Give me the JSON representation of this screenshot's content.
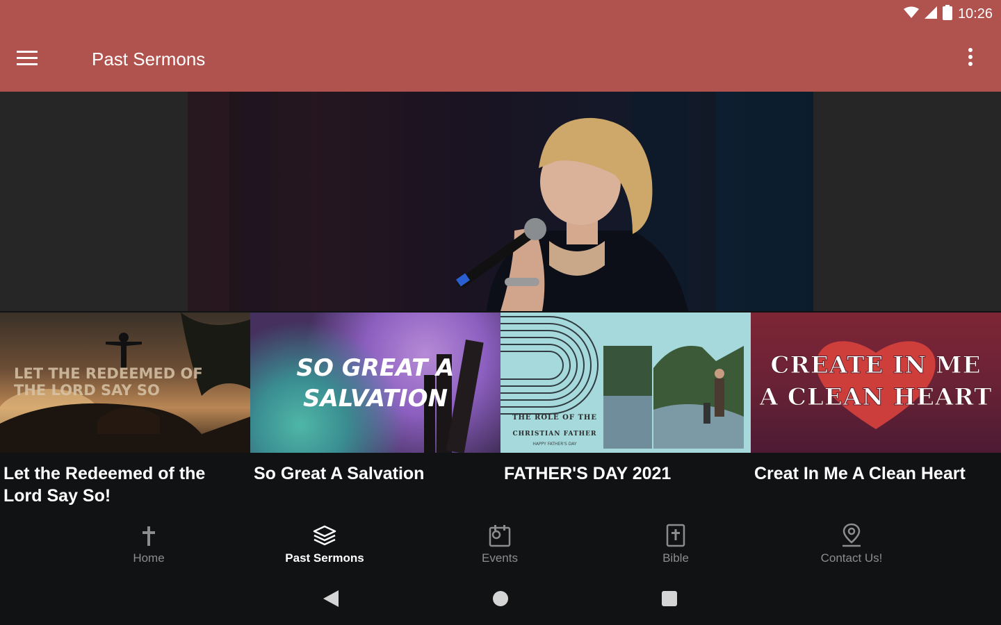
{
  "status_bar": {
    "time": "10:26",
    "icons": [
      "wifi-icon",
      "signal-icon",
      "battery-icon"
    ]
  },
  "app_bar": {
    "title": "Past Sermons",
    "menu_icon": "menu-icon",
    "overflow_icon": "more-vert-icon",
    "color": "#b0534e"
  },
  "sermons": [
    {
      "title": "Let the Redeemed of the Lord Say So!",
      "thumb_text": "LET THE REDEEMED OF THE LORD SAY SO"
    },
    {
      "title": "So Great A Salvation",
      "thumb_text": "SO GREAT A SALVATION"
    },
    {
      "title": "FATHER'S DAY 2021",
      "thumb_text_1": "THE ROLE OF THE",
      "thumb_text_2": "CHRISTIAN FATHER",
      "thumb_text_3": "HAPPY FATHER'S DAY"
    },
    {
      "title": "Creat In Me A Clean Heart",
      "thumb_text_1": "CREATE IN ME",
      "thumb_text_2": "A CLEAN HEART"
    }
  ],
  "bottom_nav": {
    "items": [
      {
        "label": "Home",
        "icon": "cross-icon",
        "active": false
      },
      {
        "label": "Past Sermons",
        "icon": "layers-icon",
        "active": true
      },
      {
        "label": "Events",
        "icon": "calendar-icon",
        "active": false
      },
      {
        "label": "Bible",
        "icon": "bible-icon",
        "active": false
      },
      {
        "label": "Contact Us!",
        "icon": "location-pin-icon",
        "active": false
      }
    ]
  },
  "system_nav": {
    "icons": [
      "back-icon",
      "home-icon",
      "recents-icon"
    ]
  }
}
